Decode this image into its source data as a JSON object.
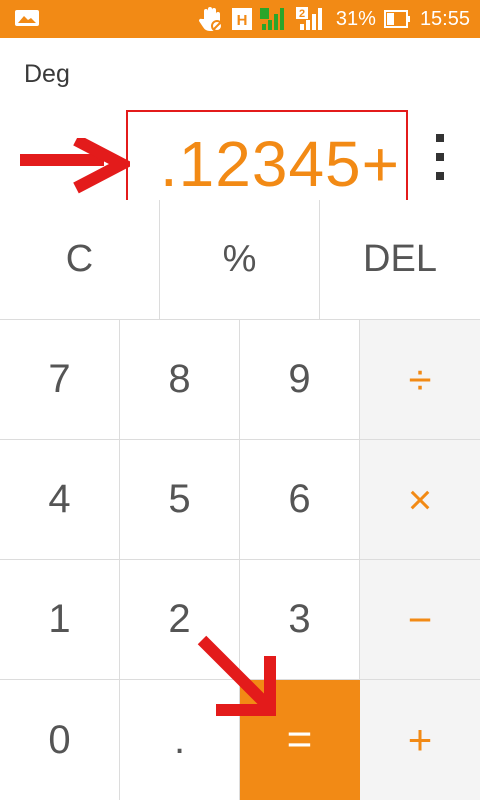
{
  "status_bar": {
    "signal_label": "2",
    "battery": "31%",
    "time": "15:55",
    "accent": "#f28a15",
    "icons": [
      "picture-icon",
      "hand-icon",
      "h-icon",
      "data-signal-icon",
      "signal-bars-icon",
      "battery-icon"
    ]
  },
  "display": {
    "mode": "Deg",
    "expression": ".12345+"
  },
  "keys": {
    "clear": "C",
    "percent": "%",
    "delete": "DEL",
    "seven": "7",
    "eight": "8",
    "nine": "9",
    "divide": "÷",
    "four": "4",
    "five": "5",
    "six": "6",
    "multiply": "×",
    "one": "1",
    "two": "2",
    "three": "3",
    "minus": "−",
    "zero": "0",
    "dot": ".",
    "equals": "=",
    "plus": "+"
  },
  "colors": {
    "accent": "#f28a15",
    "annotation": "#e31b1b"
  }
}
